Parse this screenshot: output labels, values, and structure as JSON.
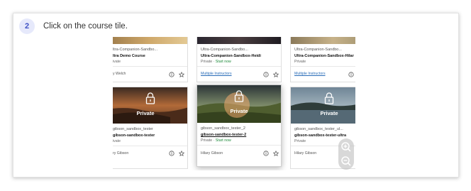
{
  "instruction": {
    "step_number": "2",
    "text": "Click on the course tile."
  },
  "courses": [
    {
      "id": "ultra-demo",
      "name_short": "ltra-Companion-Sandbo...",
      "title": "ltra Demo Course",
      "privacy": "ivate",
      "instructor": "y Welch"
    },
    {
      "id": "heidi",
      "name_short": "Ultra-Companion-Sandbo...",
      "title": "Ultra-Companion-Sandbox-Heidi",
      "privacy": "Private",
      "separator": "·",
      "start_label": "Start now",
      "instructor": "Multiple Instructors"
    },
    {
      "id": "hilary",
      "name_short": "Ultra-Companion-Sandbo...",
      "title": "Ultra-Companion-Sandbox-Hilar",
      "privacy": "Private",
      "instructor": "Multiple Instructors"
    },
    {
      "id": "gibson-tester",
      "overlay_label": "Private",
      "name_short": "gibson_sandbox_tester",
      "title": "gibson-sandbox-tester",
      "privacy": "ivate",
      "instructor": "ry Gibson"
    },
    {
      "id": "gibson-tester-2",
      "overlay_label": "Private",
      "name_short": "gibson_sandbox_tester_2",
      "title": "gibson-sandbox-tester-2",
      "privacy": "Private",
      "separator": "·",
      "start_label": "Start now",
      "instructor": "Hilary Gibson"
    },
    {
      "id": "gibson-tester-ultra",
      "overlay_label": "Private",
      "name_short": "gibson_sandbox_tester_ul...",
      "title": "gibson-sandbox-tester-ultra",
      "privacy": "Private",
      "instructor": "Hilary Gibson"
    }
  ],
  "colors": {
    "accent": "#3f51c4",
    "link": "#2a6db8",
    "start": "#1d8a3a"
  }
}
